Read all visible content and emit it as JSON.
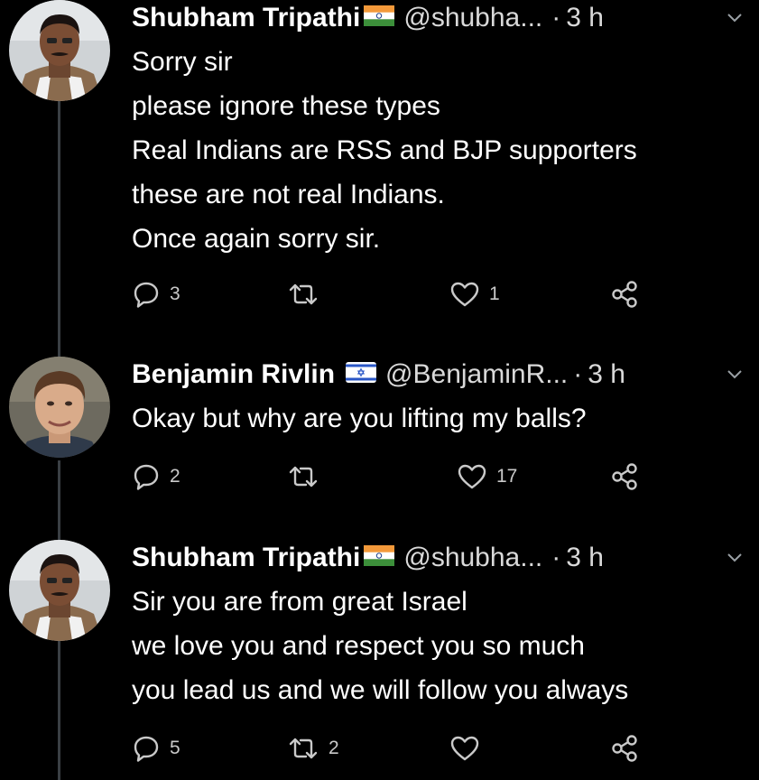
{
  "tweets": [
    {
      "author": "Shubham Tripathi",
      "flag": "india-flag",
      "handle": "@shubha...",
      "separator": "·",
      "time": "3 h",
      "lines": [
        "Sorry sir",
        "please ignore these types",
        "Real Indians are RSS and BJP supporters",
        "these are not real Indians.",
        "Once again sorry sir."
      ],
      "reply_count": "3",
      "retweet_count": "",
      "like_count": "1"
    },
    {
      "author": "Benjamin Rivlin",
      "flag": "israel-flag",
      "handle": "@BenjaminR...",
      "separator": "·",
      "time": "3 h",
      "lines": [
        "Okay but why are you lifting my balls?"
      ],
      "reply_count": "2",
      "retweet_count": "",
      "like_count": "17"
    },
    {
      "author": "Shubham Tripathi",
      "flag": "india-flag",
      "handle": "@shubha...",
      "separator": "·",
      "time": "3 h",
      "lines": [
        "Sir you are from great Israel",
        "we love you and respect you so much",
        "you lead us and we will follow you always"
      ],
      "reply_count": "5",
      "retweet_count": "2",
      "like_count": ""
    }
  ],
  "colors": {
    "background": "#000000",
    "text": "#ffffff",
    "secondary": "#d9d9d9",
    "icon": "#c9c9c9",
    "thread_line": "#3a3f44"
  }
}
